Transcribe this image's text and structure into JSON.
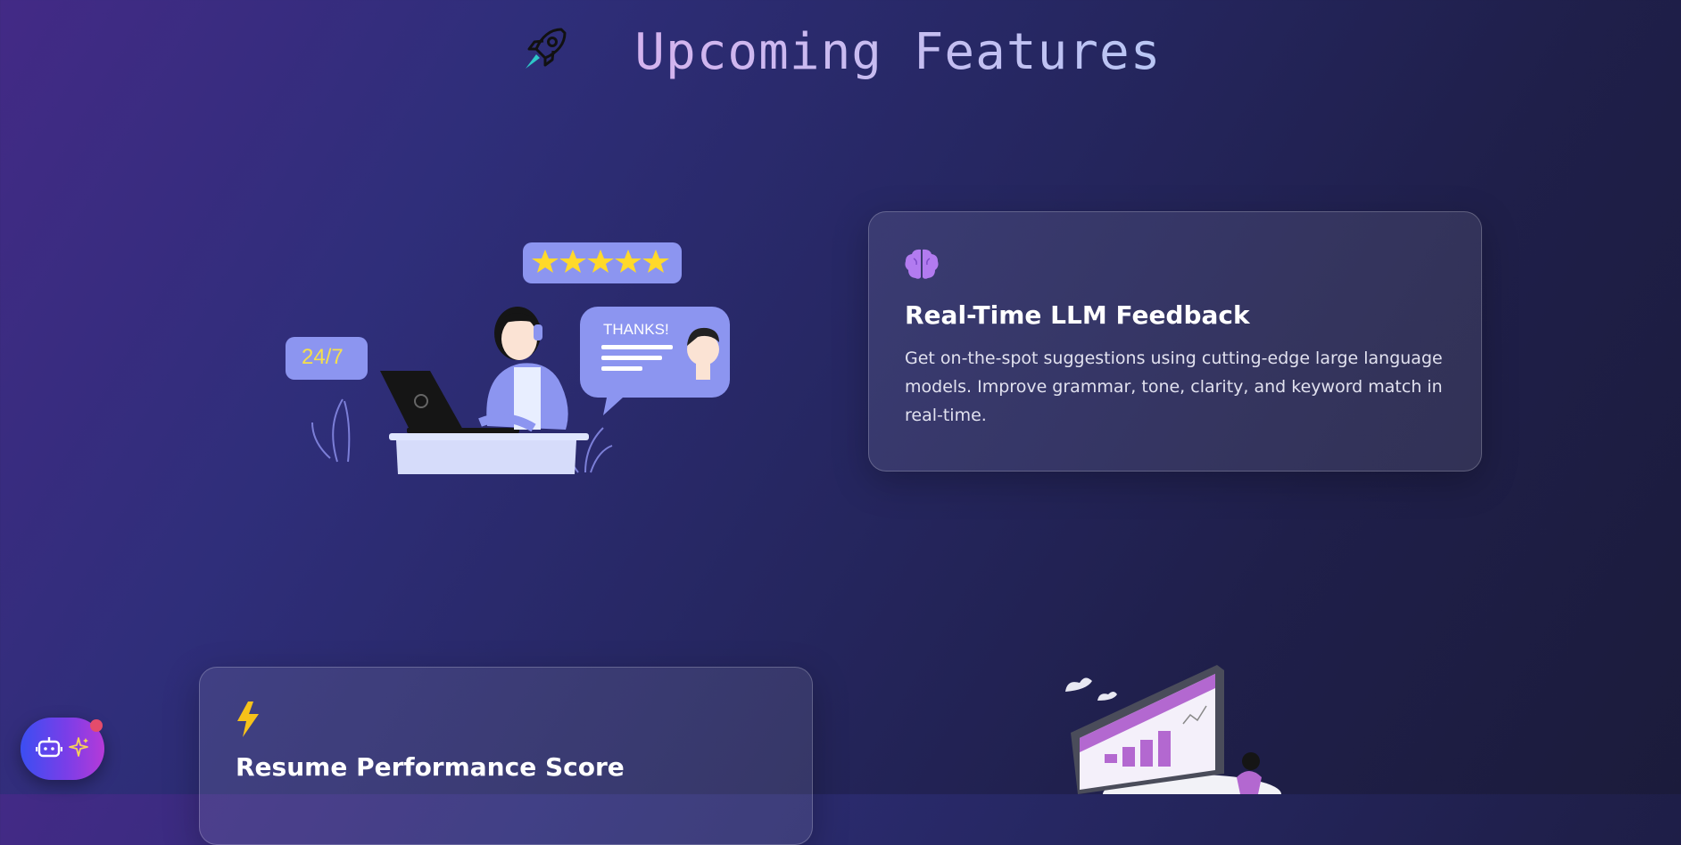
{
  "header": {
    "title": "Upcoming Features",
    "icon": "rocket-icon"
  },
  "illustration_support": {
    "badge_text": "24/7",
    "bubble_text": "THANKS!",
    "rating_stars": 5
  },
  "features": [
    {
      "icon": "brain-icon",
      "title": "Real-Time LLM Feedback",
      "description": "Get on-the-spot suggestions using cutting-edge large language models. Improve grammar, tone, clarity, and keyword match in real-time."
    },
    {
      "icon": "lightning-icon",
      "title": "Resume Performance Score"
    }
  ],
  "chat_fab": {
    "icon": "robot-icon",
    "secondary_icon": "sparkle-icon"
  },
  "colors": {
    "brain": "#b27bf0",
    "lightning": "#f6c21a",
    "accent_illustration": "#8c95f0"
  }
}
